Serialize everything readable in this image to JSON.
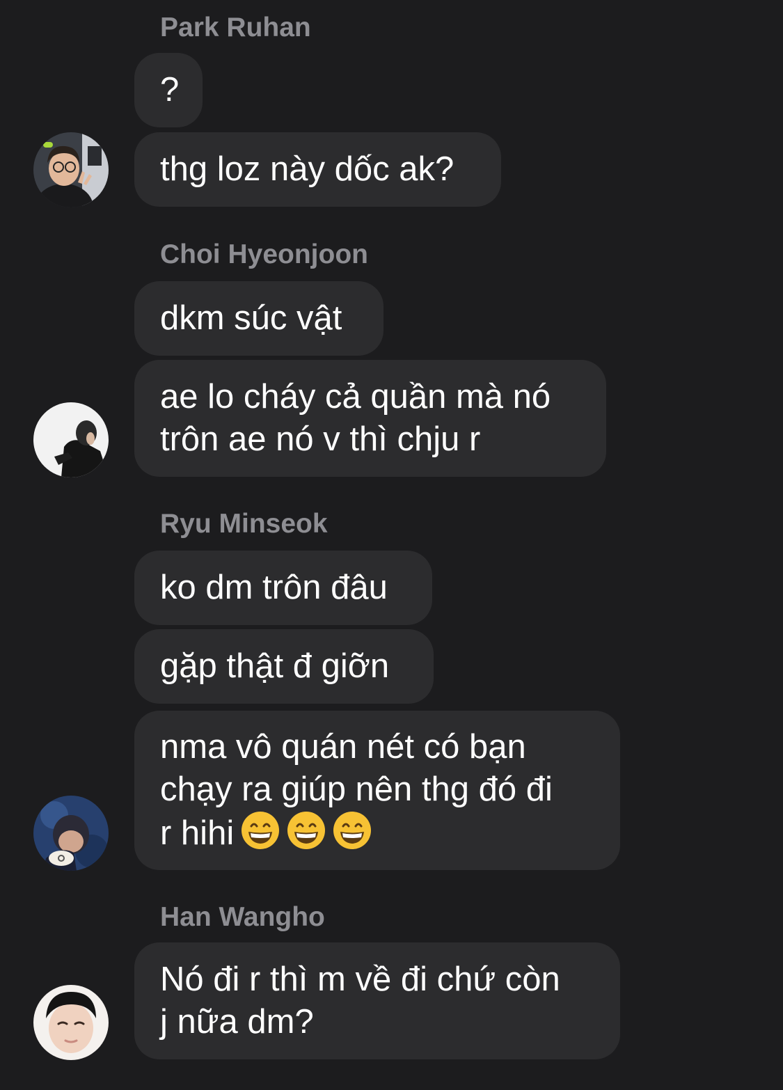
{
  "conversation": {
    "groups": [
      {
        "sender": "Park Ruhan",
        "messages": [
          "?",
          "thg loz này dốc ak?"
        ],
        "avatar_icon": "avatar-photo-icon"
      },
      {
        "sender": "Choi Hyeonjoon",
        "messages": [
          "dkm súc vật",
          "ae lo cháy cả quần mà nó\ntrôn ae nó v thì chju r"
        ],
        "avatar_icon": "avatar-photo-icon"
      },
      {
        "sender": "Ryu Minseok",
        "messages": [
          "ko dm trôn đâu",
          "gặp thật đ giỡn",
          "nma vô quán nét có bạn\nchạy ra giúp nên thg đó đi\nr hihi"
        ],
        "emoji_suffix": [
          "grinning-face-icon",
          "grinning-face-icon",
          "grinning-face-icon"
        ],
        "avatar_icon": "avatar-photo-icon"
      },
      {
        "sender": "Han Wangho",
        "messages": [
          "Nó đi r thì m về đi chứ còn\nj nữa dm?"
        ],
        "avatar_icon": "avatar-photo-icon"
      }
    ]
  },
  "colors": {
    "background": "#1c1c1e",
    "bubble": "#2c2c2e",
    "sender_name": "#8e8e93",
    "message_text": "#ffffff"
  }
}
